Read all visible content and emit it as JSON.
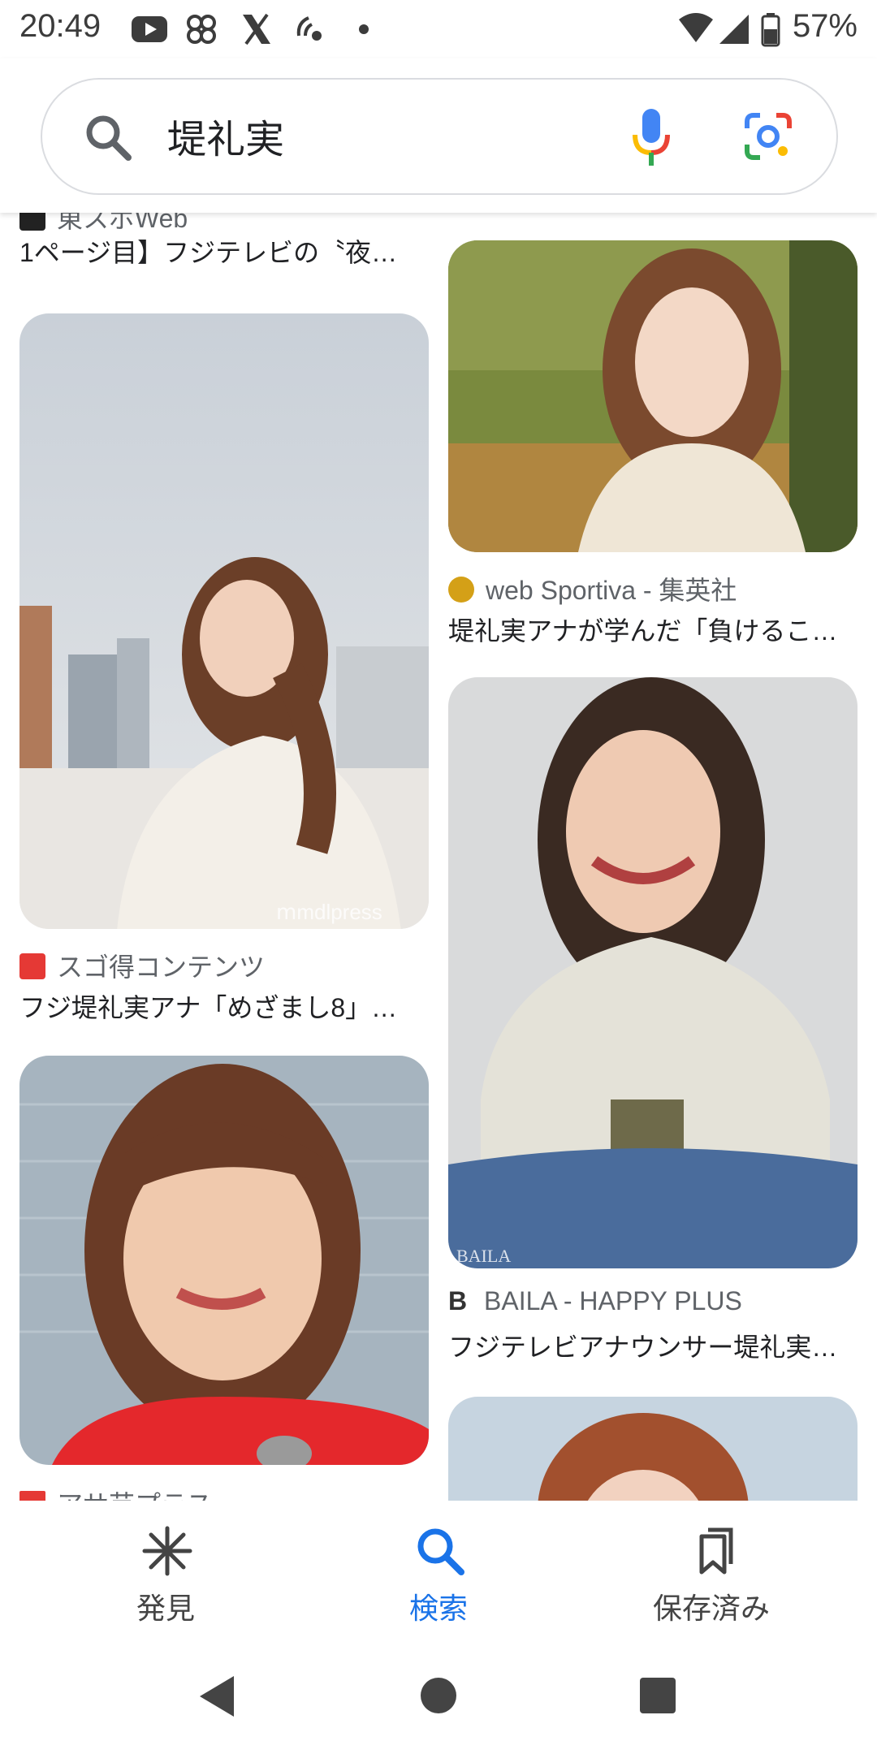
{
  "status_bar": {
    "time": "20:49",
    "battery": "57%",
    "icons_left": [
      "youtube-icon",
      "pinwheel-icon",
      "x-icon",
      "wifi-calling-icon",
      "dot-icon"
    ],
    "icons_right": [
      "wifi-icon",
      "signal-icon",
      "battery-icon"
    ]
  },
  "search": {
    "query": "堤礼実",
    "icons": [
      "search-icon",
      "mic-icon",
      "lens-icon"
    ]
  },
  "results": [
    {
      "source": "東スポWeb",
      "title": "1ページ目】フジテレビの〝夜…",
      "favicon_color": "#222222"
    },
    {
      "source": "web Sportiva - 集英社",
      "title": "堤礼実アナが学んだ「負けるこ…",
      "favicon_color": "#d4a017"
    },
    {
      "source": "スゴ得コンテンツ",
      "title": "フジ堤礼実アナ「めざまし8」…",
      "favicon_color": "#e53935"
    },
    {
      "source": "BAILA - HAPPY PLUS",
      "title": "フジテレビアナウンサー堤礼実…",
      "favicon_color": "#333333"
    },
    {
      "source": "アサ芸プラス",
      "title": "",
      "favicon_color": "#e53935"
    }
  ],
  "watermarks": {
    "modelpress": "mdlpress",
    "baila": "BAILA"
  },
  "bottom_nav": [
    {
      "label": "発見",
      "icon": "asterisk-icon",
      "active": false
    },
    {
      "label": "検索",
      "icon": "search-icon",
      "active": true
    },
    {
      "label": "保存済み",
      "icon": "bookmarks-icon",
      "active": false
    }
  ],
  "colors": {
    "accent": "#1a73e8",
    "text": "#202124",
    "secondary": "#5f6368"
  }
}
